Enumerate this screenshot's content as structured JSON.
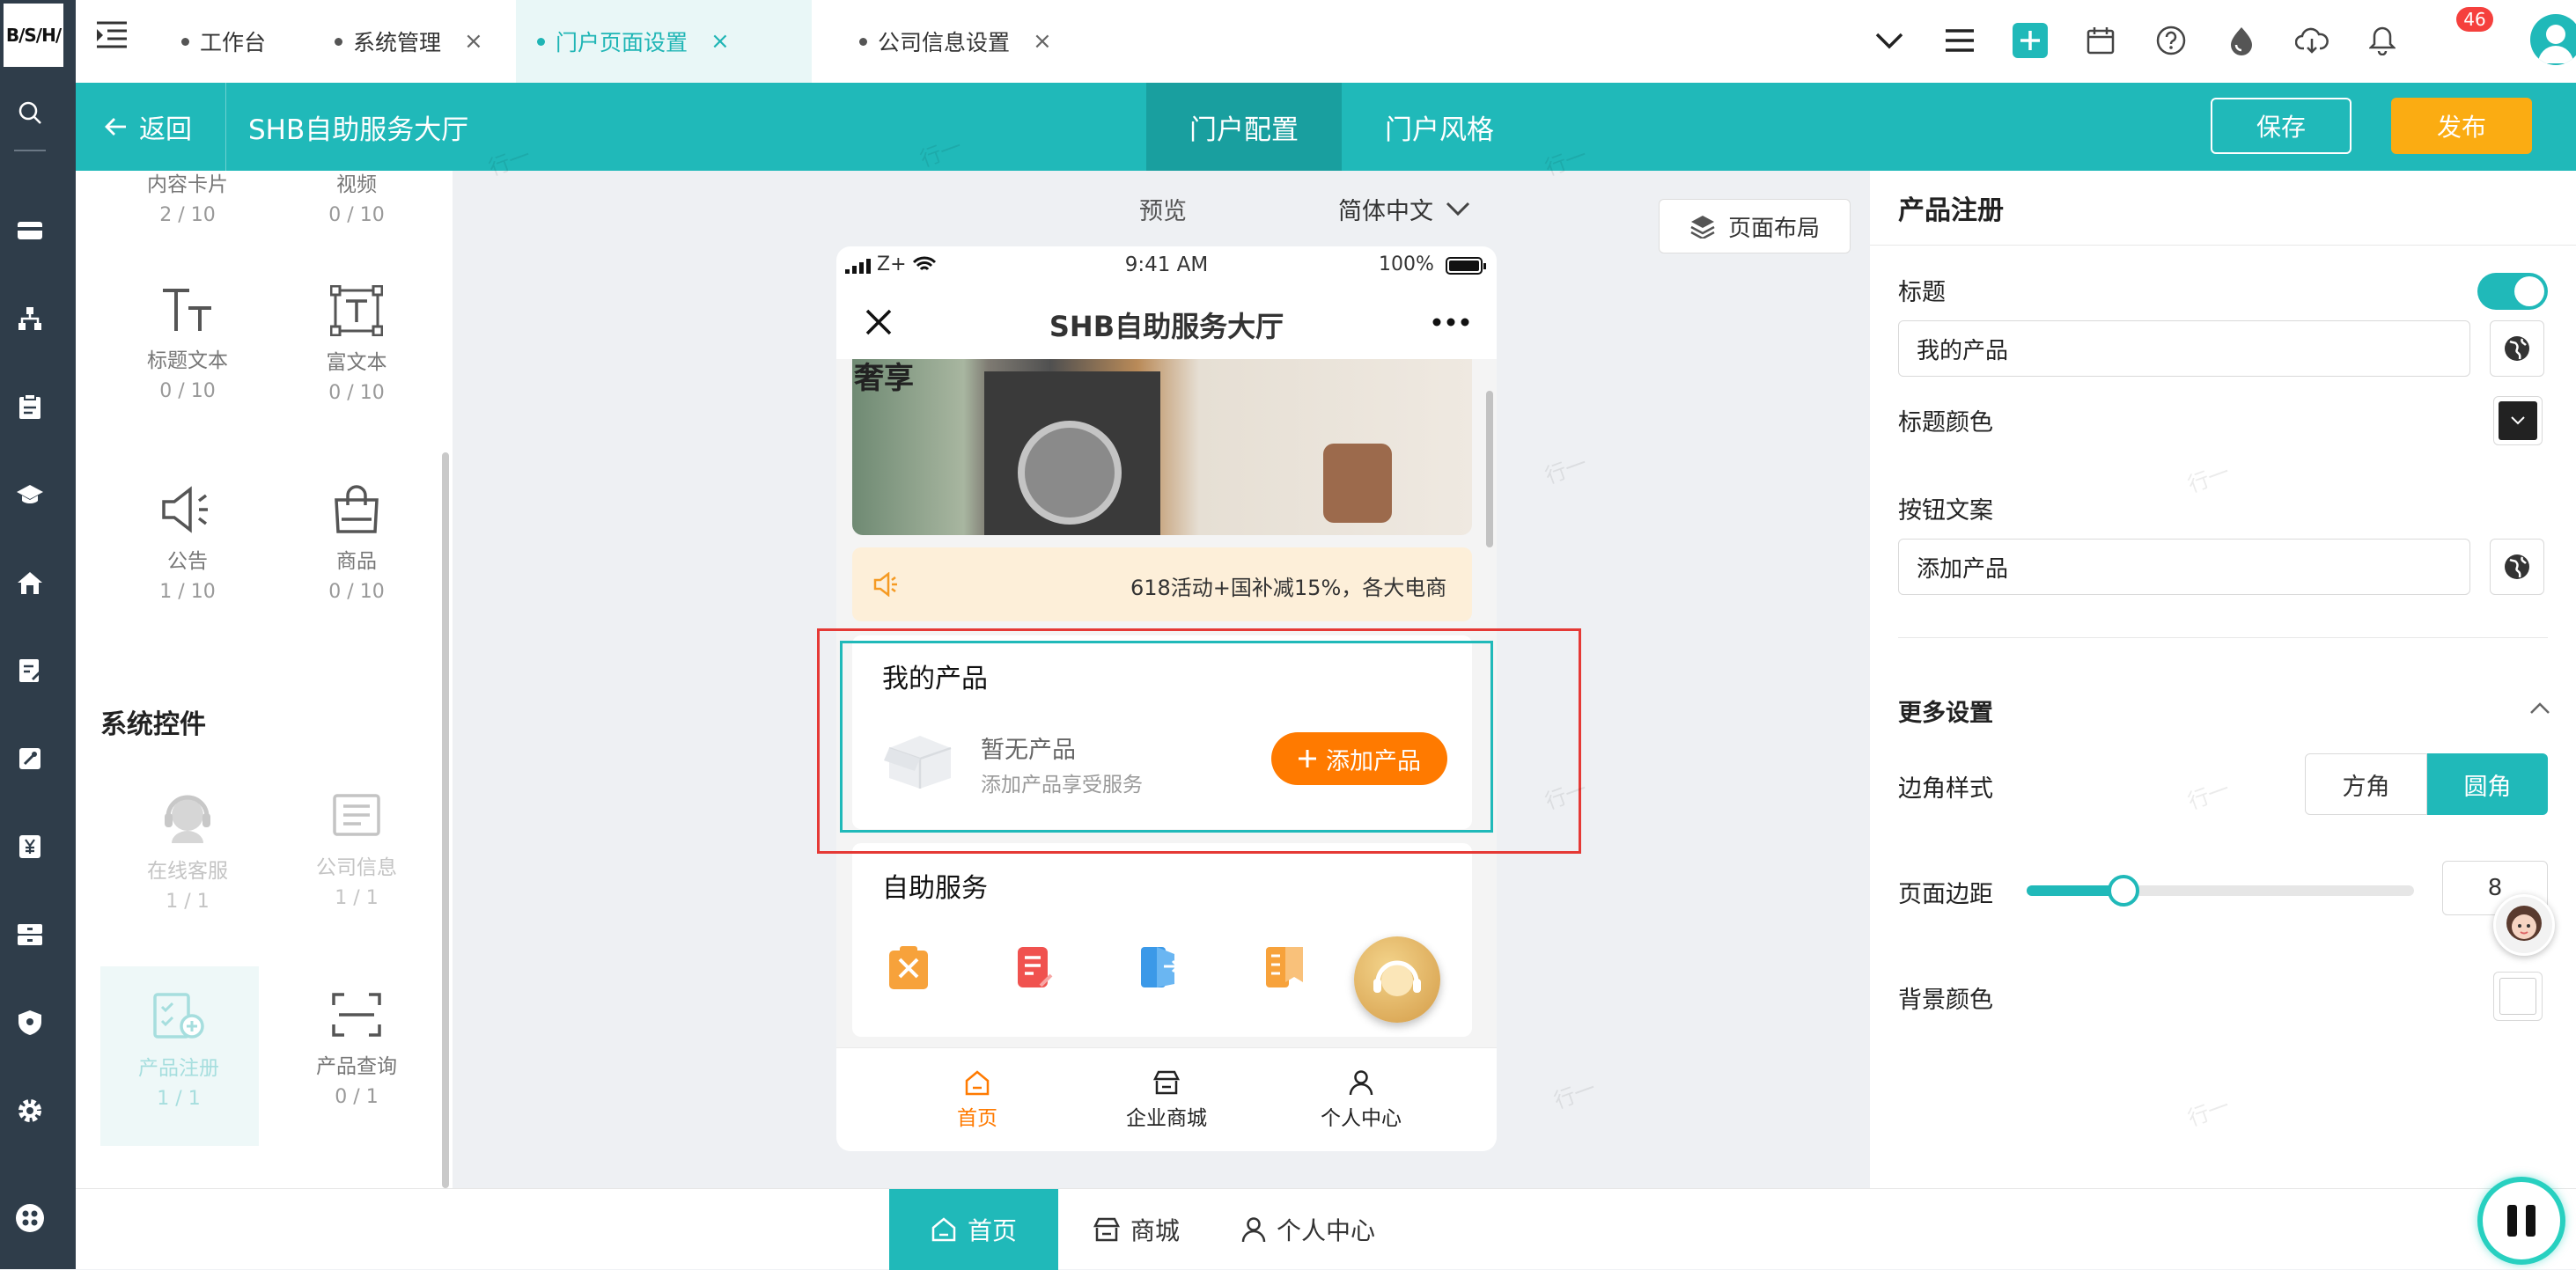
{
  "app": {
    "logo_text": "B/S/H/"
  },
  "tabs": [
    {
      "label": "工作台",
      "closable": false
    },
    {
      "label": "系统管理",
      "closable": true
    },
    {
      "label": "门户页面设置",
      "closable": true,
      "active": true
    },
    {
      "label": "公司信息设置",
      "closable": true
    }
  ],
  "close_glyph": "×",
  "notification_count": "46",
  "header": {
    "back_label": "返回",
    "title": "SHB自助服务大厅",
    "tab_config": "门户配置",
    "tab_style": "门户风格",
    "save_label": "保存",
    "publish_label": "发布"
  },
  "left_panel": {
    "widgets_top": [
      {
        "label": "内容卡片",
        "count": "2 / 10"
      },
      {
        "label": "视频",
        "count": "0 / 10"
      },
      {
        "label": "标题文本",
        "count": "0 / 10"
      },
      {
        "label": "富文本",
        "count": "0 / 10"
      },
      {
        "label": "公告",
        "count": "1 / 10"
      },
      {
        "label": "商品",
        "count": "0 / 10"
      }
    ],
    "system_section_title": "系统控件",
    "system_widgets": [
      {
        "label": "在线客服",
        "count": "1 / 1"
      },
      {
        "label": "公司信息",
        "count": "1 / 1"
      },
      {
        "label": "产品注册",
        "count": "1 / 1"
      },
      {
        "label": "产品查询",
        "count": "0 / 1"
      }
    ]
  },
  "canvas": {
    "preview_label": "预览",
    "language_label": "简体中文",
    "layout_button": "页面布局",
    "watermark": "行一",
    "phone": {
      "carrier": "Z+",
      "time": "9:41 AM",
      "battery": "100%",
      "title": "SHB自助服务大厅",
      "banner_text": "奢享",
      "notice_text": "618活动+国补减15%，各大电商",
      "product_section_title": "我的产品",
      "empty_title": "暂无产品",
      "empty_subtitle": "添加产品享受服务",
      "add_button": "添加产品",
      "self_service_title": "自助服务",
      "tabbar": [
        {
          "label": "首页",
          "icon": "home-icon",
          "active": true
        },
        {
          "label": "企业商城",
          "icon": "store-icon"
        },
        {
          "label": "个人中心",
          "icon": "user-icon"
        }
      ]
    }
  },
  "right_panel": {
    "title": "产品注册",
    "title_label": "标题",
    "title_value": "我的产品",
    "title_enabled": true,
    "title_color_label": "标题颜色",
    "button_text_label": "按钮文案",
    "button_text_value": "添加产品",
    "more_settings": "更多设置",
    "corner_style_label": "边角样式",
    "corner_square": "方角",
    "corner_round": "圆角",
    "corner_selected": "圆角",
    "page_margin_label": "页面边距",
    "page_margin_value": "8",
    "page_margin_fraction": 0.25,
    "bg_color_label": "背景颜色",
    "title_color": "#222222",
    "bg_color": "#ffffff"
  },
  "bottom_bar": [
    {
      "label": "首页",
      "icon": "home-icon",
      "active": true
    },
    {
      "label": "商城",
      "icon": "store-icon"
    },
    {
      "label": "个人中心",
      "icon": "user-icon"
    }
  ],
  "colors": {
    "brand": "#20b9b9",
    "publish": "#fbac12",
    "accent_orange": "#ff7a00",
    "selection_red": "#e53935"
  }
}
